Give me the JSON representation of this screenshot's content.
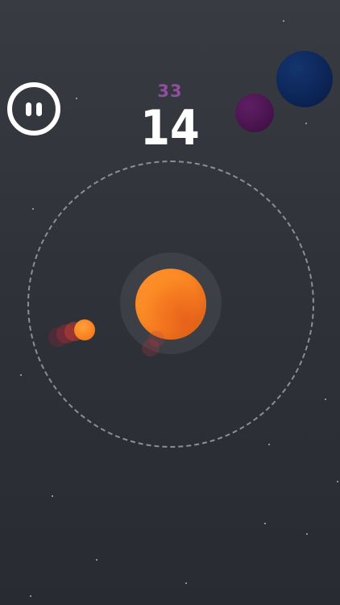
{
  "hud": {
    "best_score": "33",
    "current_score": "14",
    "pause_icon": "pause-icon"
  },
  "colors": {
    "background_top": "#393b42",
    "background_bottom": "#292b32",
    "best_score": "#8e4f9e",
    "current_score": "#ffffff",
    "sun": "#fb8b25",
    "player": "#f98220",
    "planet_blue": "#0d2659",
    "planet_purple": "#4a1450",
    "orbit_ring": "#8c8e95"
  }
}
